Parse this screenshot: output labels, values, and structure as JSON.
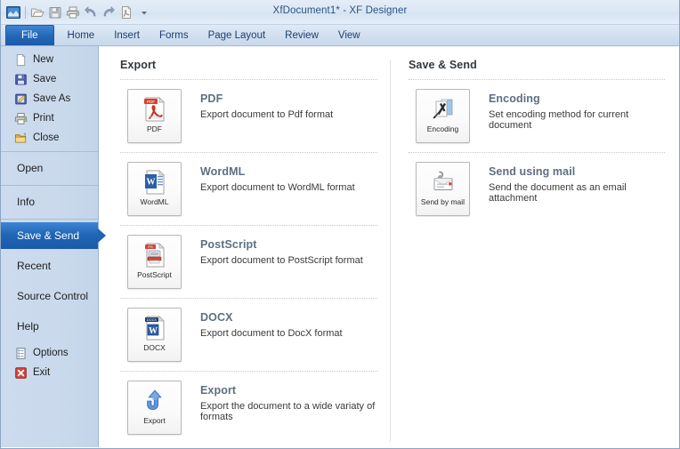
{
  "titlebar": {
    "title": "XfDocument1* - XF Designer",
    "quick_access": [
      {
        "name": "app-icon",
        "tip": "XF Designer"
      },
      {
        "name": "open-icon",
        "tip": "Open"
      },
      {
        "name": "save-icon",
        "tip": "Save"
      },
      {
        "name": "print-icon",
        "tip": "Print"
      },
      {
        "name": "undo-icon",
        "tip": "Undo"
      },
      {
        "name": "redo-icon",
        "tip": "Redo"
      },
      {
        "name": "export-pdf-icon",
        "tip": "Export to PDF"
      },
      {
        "name": "customize-chevron-icon",
        "tip": "Customize Quick Access Toolbar"
      }
    ]
  },
  "ribbon": {
    "tabs": [
      {
        "label": "File",
        "active": true
      },
      {
        "label": "Home",
        "active": false
      },
      {
        "label": "Insert",
        "active": false
      },
      {
        "label": "Forms",
        "active": false
      },
      {
        "label": "Page Layout",
        "active": false
      },
      {
        "label": "Review",
        "active": false
      },
      {
        "label": "View",
        "active": false
      }
    ]
  },
  "sidebar": {
    "commands": [
      {
        "label": "New",
        "icon": "new-document-icon"
      },
      {
        "label": "Save",
        "icon": "floppy-disk-icon"
      },
      {
        "label": "Save As",
        "icon": "save-as-icon"
      },
      {
        "label": "Print",
        "icon": "printer-icon"
      },
      {
        "label": "Close",
        "icon": "folder-close-icon"
      }
    ],
    "pages": [
      {
        "label": "Open",
        "selected": false
      },
      {
        "label": "Info",
        "selected": false
      },
      {
        "label": "Save & Send",
        "selected": true
      },
      {
        "label": "Recent",
        "selected": false
      },
      {
        "label": "Source Control",
        "selected": false
      },
      {
        "label": "Help",
        "selected": false
      }
    ],
    "footer": [
      {
        "label": "Options",
        "icon": "options-icon"
      },
      {
        "label": "Exit",
        "icon": "exit-icon"
      }
    ]
  },
  "export_panel": {
    "heading": "Export",
    "items": [
      {
        "tile_label": "PDF",
        "icon": "pdf-file-icon",
        "title": "PDF",
        "description": "Export document to Pdf format"
      },
      {
        "tile_label": "WordML",
        "icon": "wordml-file-icon",
        "title": "WordML",
        "description": "Export document to WordML format"
      },
      {
        "tile_label": "PostScript",
        "icon": "postscript-file-icon",
        "title": "PostScript",
        "description": "Export document to PostScript format"
      },
      {
        "tile_label": "DOCX",
        "icon": "docx-file-icon",
        "title": "DOCX",
        "description": "Export document to DocX format"
      },
      {
        "tile_label": "Export",
        "icon": "export-arrow-icon",
        "title": "Export",
        "description": "Export the document to a wide variaty of formats"
      }
    ]
  },
  "save_send_panel": {
    "heading": "Save & Send",
    "items": [
      {
        "tile_label": "Encoding",
        "icon": "encoding-icon",
        "title": "Encoding",
        "description": "Set encoding method for current document"
      },
      {
        "tile_label": "Send by mail",
        "icon": "envelope-attachment-icon",
        "title": "Send using mail",
        "description": "Send the document as an email attachment"
      }
    ]
  },
  "colors": {
    "accent_blue": "#1f64b4",
    "titlebar_text": "#2b5286",
    "sidebar_bg": "#c9d9ec",
    "entry_title": "#5e6f82",
    "heading": "#31393f"
  }
}
